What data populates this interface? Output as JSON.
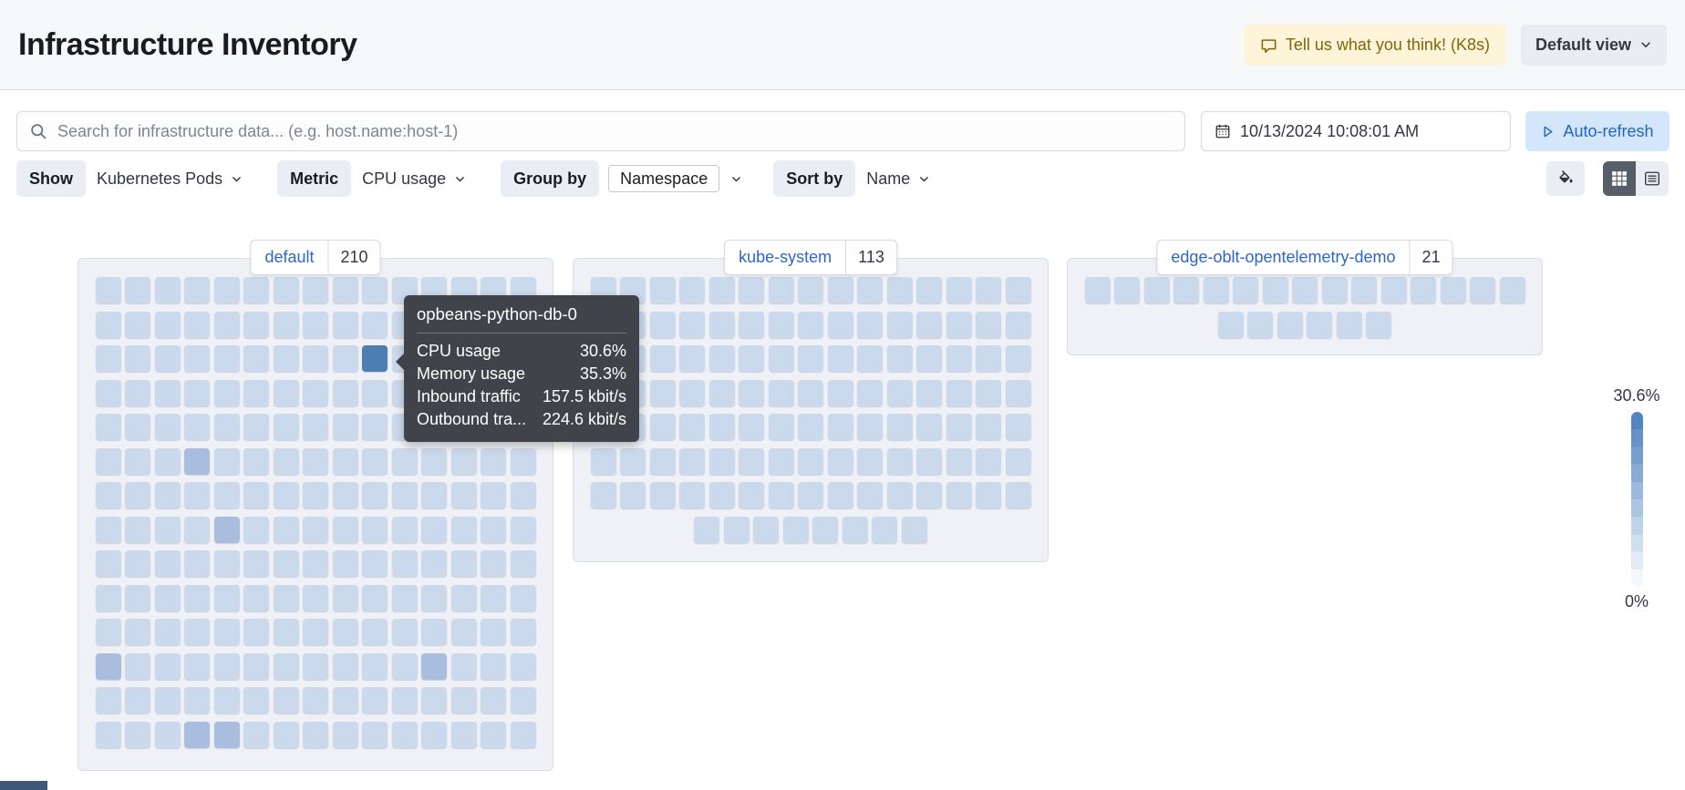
{
  "header": {
    "title": "Infrastructure Inventory",
    "feedback_button": "Tell us what you think! (K8s)",
    "view_selector": "Default view"
  },
  "search": {
    "placeholder": "Search for infrastructure data... (e.g. host.name:host-1)"
  },
  "time": {
    "datetime": "10/13/2024 10:08:01 AM",
    "auto_refresh_label": "Auto-refresh"
  },
  "toolbar": {
    "show_label": "Show",
    "show_value": "Kubernetes Pods",
    "metric_label": "Metric",
    "metric_value": "CPU usage",
    "group_by_label": "Group by",
    "group_by_value": "Namespace",
    "sort_by_label": "Sort by",
    "sort_by_value": "Name",
    "icons": [
      "paint-fill-icon",
      "waffle-map-icon",
      "table-view-icon"
    ]
  },
  "groups": [
    {
      "name": "default",
      "count": "210",
      "columns": 15,
      "total": 210,
      "selected_index": 39,
      "medium_indices": [
        78,
        109,
        165,
        176,
        198,
        199
      ]
    },
    {
      "name": "kube-system",
      "count": "113",
      "columns": 15,
      "total": 113,
      "selected_index": -1,
      "medium_indices": []
    },
    {
      "name": "edge-oblt-opentelemetry-demo",
      "count": "21",
      "columns": 15,
      "total": 21,
      "selected_index": -1,
      "medium_indices": []
    }
  ],
  "tooltip": {
    "title": "opbeans-python-db-0",
    "rows": [
      {
        "label": "CPU usage",
        "value": "30.6%"
      },
      {
        "label": "Memory usage",
        "value": "35.3%"
      },
      {
        "label": "Inbound traffic",
        "value": "157.5 kbit/s"
      },
      {
        "label": "Outbound tra...",
        "value": "224.6 kbit/s"
      }
    ]
  },
  "legend": {
    "max": "30.6%",
    "min": "0%",
    "steps": [
      "#5386c0",
      "#6593c7",
      "#779fcd",
      "#89acd4",
      "#9bb9db",
      "#acc5e1",
      "#bed2e8",
      "#d0dfef",
      "#e2ebf5",
      "#f4f8fc"
    ]
  },
  "colors": {
    "cell": "#cbd9ec",
    "cell_medium": "#a9bedf",
    "cell_selected": "#4d7db3",
    "link_blue": "#2e67c6",
    "feedback_bg": "#fdf4d9",
    "autorefresh_bg": "#d4e6f9",
    "tooltip_bg": "#404349"
  }
}
